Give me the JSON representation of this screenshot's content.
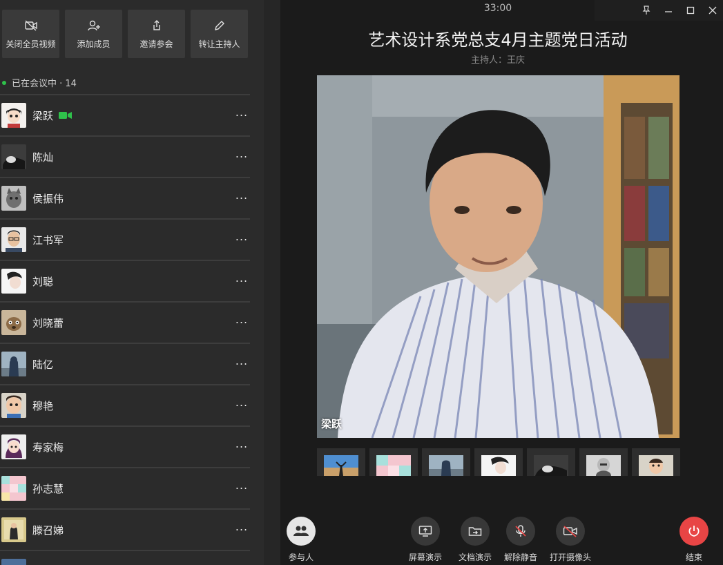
{
  "toolbar": {
    "buttons": [
      {
        "label": "关闭全员视频",
        "icon": "camera-off-icon"
      },
      {
        "label": "添加成员",
        "icon": "add-user-icon"
      },
      {
        "label": "邀请参会",
        "icon": "share-icon"
      },
      {
        "label": "转让主持人",
        "icon": "pen-icon"
      }
    ]
  },
  "status": {
    "text": "已在会议中 · 14",
    "color": "#2fc14b"
  },
  "members": [
    {
      "name": "梁跃",
      "camera_on": true
    },
    {
      "name": "陈灿"
    },
    {
      "name": "侯振伟"
    },
    {
      "name": "江书军"
    },
    {
      "name": "刘聪"
    },
    {
      "name": "刘晓蕾"
    },
    {
      "name": "陆亿"
    },
    {
      "name": "穆艳"
    },
    {
      "name": "寿家梅"
    },
    {
      "name": "孙志慧"
    },
    {
      "name": "滕召娣"
    }
  ],
  "member_more_label": "···",
  "meeting": {
    "timer": "33:00",
    "title": "艺术设计系党总支4月主题党日活动",
    "host": "主持人：王庆"
  },
  "video": {
    "speaker_label": "梁跃"
  },
  "controls": {
    "participants": "参与人",
    "screen_share": "屏幕演示",
    "doc_share": "文档演示",
    "unmute": "解除静音",
    "camera_on": "打开摄像头",
    "end": "结束"
  },
  "colors": {
    "sidebar_bg": "#2b2b2b",
    "main_bg": "#1b1b1b",
    "end_button": "#e84545",
    "camera_badge": "#2fc14b"
  }
}
